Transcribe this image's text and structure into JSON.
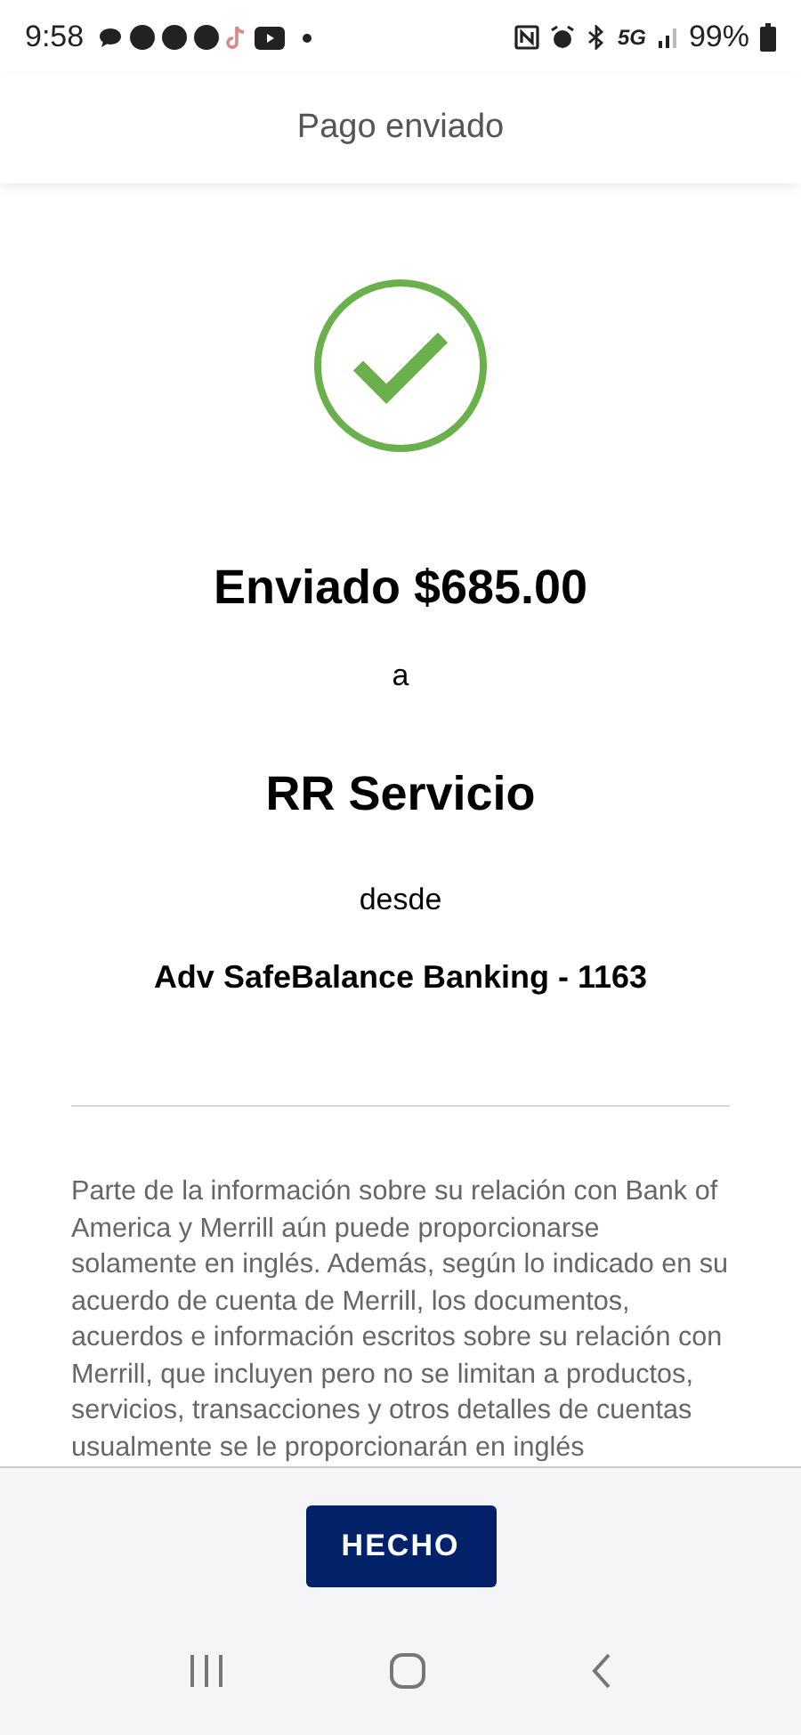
{
  "status_bar": {
    "time": "9:58",
    "network": "5G",
    "battery": "99%"
  },
  "header": {
    "title": "Pago enviado"
  },
  "confirmation": {
    "amount_line": "Enviado $685.00",
    "to_label": "a",
    "payee": "RR Servicio",
    "from_label": "desde",
    "account": "Adv SafeBalance Banking - 1163"
  },
  "disclaimer": "Parte de la información sobre su relación con Bank of America y Merrill aún puede proporcionarse solamente en inglés. Además, según lo indicado en su acuerdo de cuenta de Merrill, los documentos, acuerdos e información escritos sobre su relación con Merrill, que incluyen pero no se limitan a productos, servicios, transacciones y otros detalles de cuentas usualmente se le proporcionarán en inglés",
  "footer": {
    "button": "HECHO"
  }
}
